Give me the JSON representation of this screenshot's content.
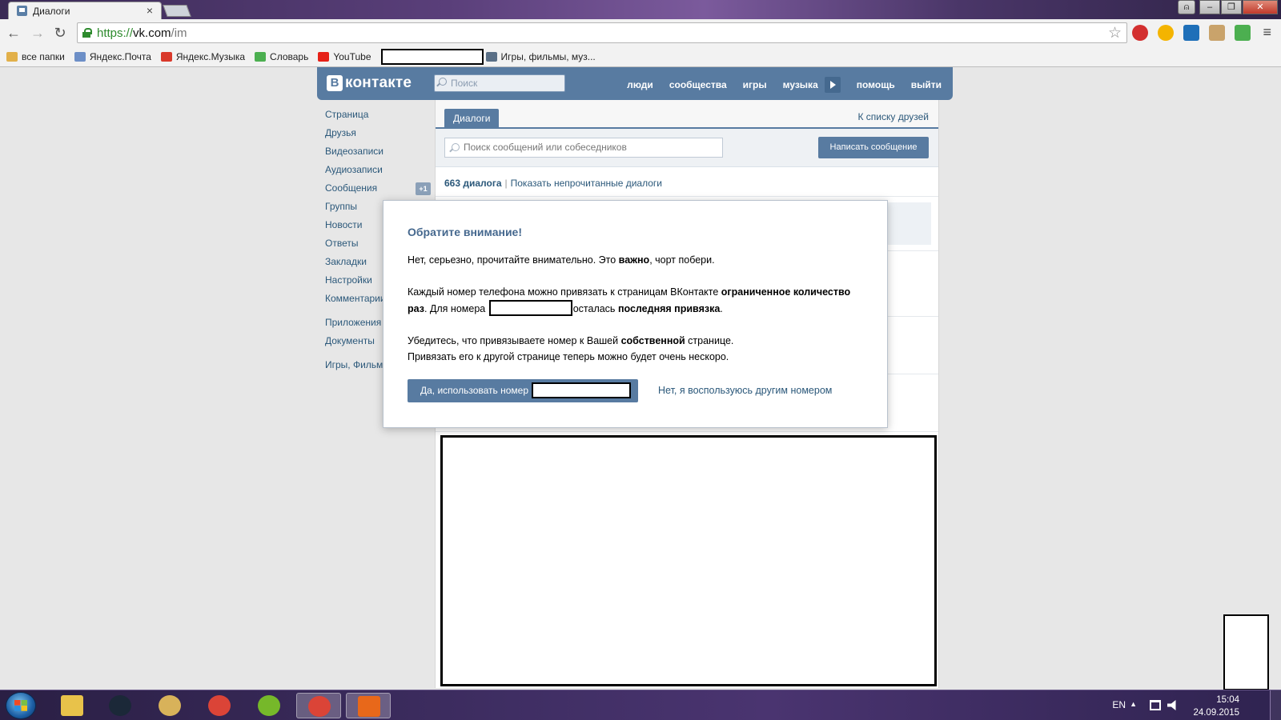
{
  "browser": {
    "tab_title": "Диалоги",
    "tab_close": "×",
    "url_scheme": "https://",
    "url_host": "vk.com",
    "url_path": "/im",
    "window_buttons": {
      "user": "⍝",
      "minimize": "–",
      "restore": "❐",
      "close": "✕"
    },
    "back": "←",
    "forward": "→",
    "reload": "↻",
    "star": "☆",
    "menu": "≡"
  },
  "bookmarks": [
    {
      "label": "все папки",
      "color": "#e2b04a"
    },
    {
      "label": "Яндекс.Почта",
      "color": "#6d8fc7"
    },
    {
      "label": "Яндекс.Музыка",
      "color": "#d9392b"
    },
    {
      "label": "Словарь",
      "color": "#4caf50"
    },
    {
      "label": "YouTube",
      "color": "#e62117"
    }
  ],
  "bookmarks_last": {
    "label": "Игры, фильмы, муз...",
    "color": "#5a6f86"
  },
  "vk": {
    "logo_letter": "В",
    "logo_text": "контакте",
    "search_placeholder": "Поиск",
    "nav": [
      "люди",
      "сообщества",
      "игры",
      "музыка"
    ],
    "nav_after": [
      "помощь",
      "выйти"
    ],
    "brand_color": "#587ba1"
  },
  "sidebar": {
    "group1": [
      "Страница",
      "Друзья",
      "Видеозаписи",
      "Аудиозаписи",
      "Сообщения",
      "Группы",
      "Новости",
      "Ответы",
      "Закладки",
      "Настройки",
      "Комментарии"
    ],
    "messages_badge": "+1",
    "group2": [
      "Приложения",
      "Документы"
    ],
    "group3": [
      "Игры, Фильмы"
    ]
  },
  "main": {
    "tab_dialogs": "Диалоги",
    "friends_link": "К списку друзей",
    "search_placeholder": "Поиск сообщений или собеседников",
    "write_button": "Написать сообщение",
    "dialog_count": "663 диалога",
    "separator": "|",
    "show_unread": "Показать непрочитанные диалоги"
  },
  "modal": {
    "title": "Обратите внимание!",
    "p1_a": "Нет, серьезно, прочитайте внимательно. Это ",
    "p1_b": "важно",
    "p1_c": ", чорт побери.",
    "p2_a": "Каждый номер телефона можно привязать к страницам ВКонтакте ",
    "p2_b": "ограниченное количество раз",
    "p2_c": ". Для номера ",
    "p2_d": "осталась ",
    "p2_e": "последняя привязка",
    "p2_f": ".",
    "p3_a": "Убедитесь, что привязываете номер к Вашей ",
    "p3_b": "собственной",
    "p3_c": " странице.",
    "p3_line2": "Привязать его к другой странице теперь можно будет очень нескоро.",
    "confirm_label": "Да, использовать номер ",
    "decline_label": "Нет, я воспользуюсь другим номером"
  },
  "taskbar": {
    "apps": [
      {
        "name": "explorer",
        "color": "#e8c24a"
      },
      {
        "name": "steam",
        "color": "#1b2838"
      },
      {
        "name": "fallout",
        "color": "#d8b25a"
      },
      {
        "name": "chrome",
        "color": "#db4437"
      },
      {
        "name": "utorrent",
        "color": "#76b82a"
      },
      {
        "name": "chrome-active",
        "color": "#db4437"
      },
      {
        "name": "app-flame",
        "color": "#e8681a"
      }
    ],
    "lang": "EN",
    "tray_arrow": "▲",
    "time": "15:04",
    "date": "24.09.2015"
  }
}
